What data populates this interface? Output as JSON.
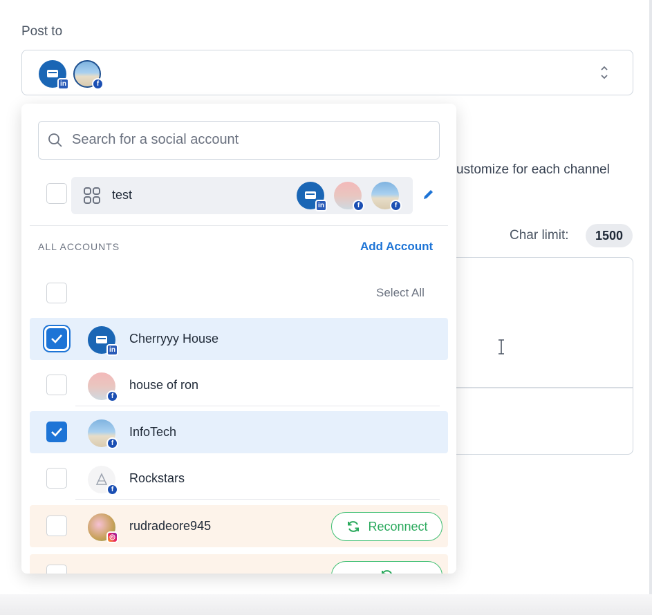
{
  "post_to": {
    "label": "Post to"
  },
  "background": {
    "customize_text": "ustomize for each channel",
    "char_limit_label": "Char limit:",
    "char_limit_value": "1500"
  },
  "dropdown": {
    "search": {
      "placeholder": "Search for a social account",
      "value": ""
    },
    "group": {
      "label": "test"
    },
    "section_label": "ALL ACCOUNTS",
    "add_account_label": "Add Account",
    "select_all_label": "Select All",
    "reconnect_label": "Reconnect",
    "accounts": [
      {
        "name": "Cherryyy House",
        "platform": "linkedin",
        "checked": true
      },
      {
        "name": "house of ron",
        "platform": "facebook",
        "checked": false
      },
      {
        "name": "InfoTech",
        "platform": "facebook",
        "checked": true
      },
      {
        "name": "Rockstars",
        "platform": "facebook",
        "checked": false
      },
      {
        "name": "rudradeore945",
        "platform": "instagram",
        "checked": false
      }
    ]
  },
  "colors": {
    "accent": "#1d74d6",
    "reconnect": "#2aa95c",
    "selected_row": "#e6f0fc",
    "warning_row": "#fdf3ea"
  }
}
